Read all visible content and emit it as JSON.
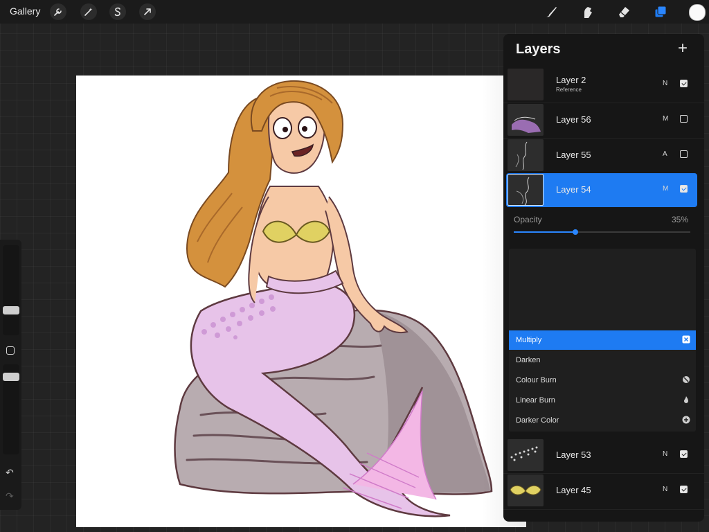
{
  "toolbar": {
    "gallery_label": "Gallery",
    "left_icons": [
      "wrench-icon",
      "magic-wand-icon",
      "selection-s-icon",
      "transform-arrow-icon"
    ],
    "right_icons": [
      "brush-icon",
      "smudge-icon",
      "eraser-icon",
      "layers-icon"
    ],
    "accent": "#1e7bf2",
    "current_color": "#fafafa"
  },
  "sidebar": {
    "brush_size_level": 0.47,
    "brush_opacity_level": 0.62,
    "modifier_icon": "square-icon",
    "undo_icon": "undo-icon",
    "redo_icon": "redo-icon"
  },
  "layers_panel": {
    "title": "Layers",
    "add_icon": "plus-icon",
    "layers_top": [
      {
        "name": "Layer 2",
        "sub": "Reference",
        "blend": "N",
        "visible": true,
        "selected": false
      },
      {
        "name": "Layer 56",
        "sub": "",
        "blend": "M",
        "visible": false,
        "selected": false
      },
      {
        "name": "Layer 55",
        "sub": "",
        "blend": "A",
        "visible": false,
        "selected": false
      },
      {
        "name": "Layer 54",
        "sub": "",
        "blend": "M",
        "visible": true,
        "selected": true
      }
    ],
    "opacity": {
      "label": "Opacity",
      "value": "35%",
      "fraction": 0.35
    },
    "blend_modes": [
      {
        "label": "Multiply",
        "icon": "multiply-icon",
        "selected": true
      },
      {
        "label": "Darken",
        "icon": "moon-icon",
        "selected": false
      },
      {
        "label": "Colour Burn",
        "icon": "colour-burn-icon",
        "selected": false
      },
      {
        "label": "Linear Burn",
        "icon": "flame-icon",
        "selected": false
      },
      {
        "label": "Darker Color",
        "icon": "plus-circle-icon",
        "selected": false
      }
    ],
    "layers_bottom": [
      {
        "name": "Layer 53",
        "sub": "",
        "blend": "N",
        "visible": true,
        "selected": false
      },
      {
        "name": "Layer 45",
        "sub": "",
        "blend": "N",
        "visible": true,
        "selected": false
      }
    ]
  }
}
